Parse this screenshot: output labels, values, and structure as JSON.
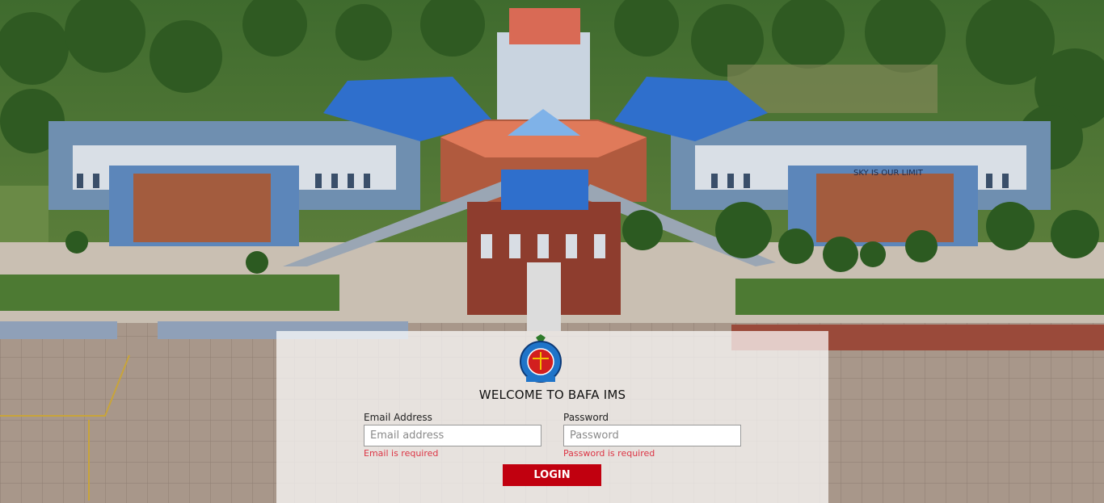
{
  "login": {
    "title": "WELCOME TO BAFA IMS",
    "email_label": "Email Address",
    "email_placeholder": "Email address",
    "email_error": "Email is required",
    "password_label": "Password",
    "password_placeholder": "Password",
    "password_error": "Password is required",
    "button_label": "LOGIN"
  },
  "background": {
    "building_sign": "SKY IS OUR LIMIT"
  },
  "colors": {
    "button": "#c1000f",
    "error": "#dc3545"
  }
}
